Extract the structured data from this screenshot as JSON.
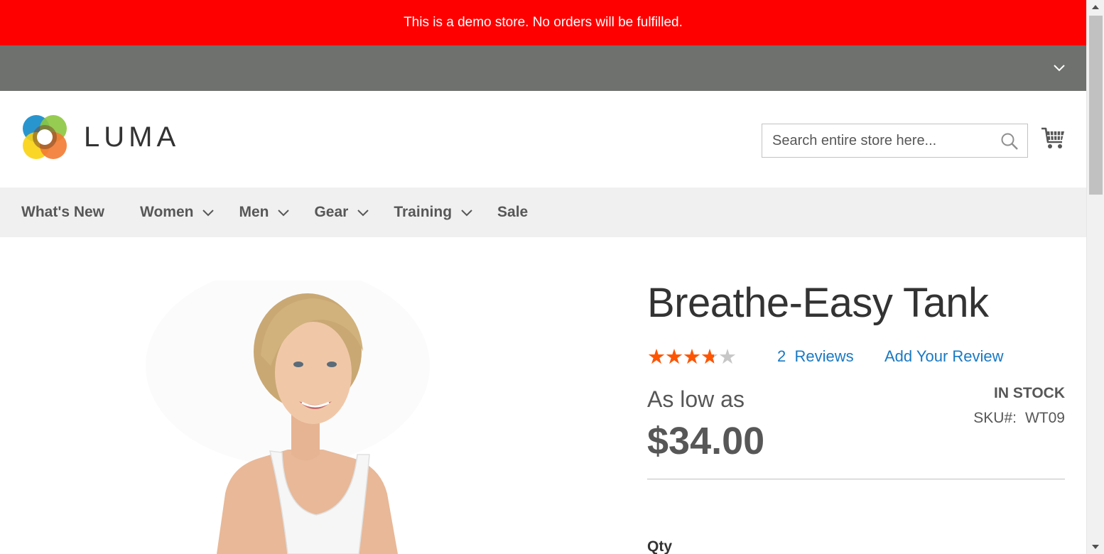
{
  "demo_notice": {
    "text": "This is a demo store. No orders will be fulfilled."
  },
  "header": {
    "logo_text": "LUMA",
    "search": {
      "placeholder": "Search entire store here...",
      "value": ""
    },
    "icons": {
      "search": "search-icon",
      "cart": "cart-icon",
      "toggle": "chevron-down-icon"
    }
  },
  "nav": {
    "items": [
      {
        "label": "What's New",
        "has_submenu": false
      },
      {
        "label": "Women",
        "has_submenu": true
      },
      {
        "label": "Men",
        "has_submenu": true
      },
      {
        "label": "Gear",
        "has_submenu": true
      },
      {
        "label": "Training",
        "has_submenu": true
      },
      {
        "label": "Sale",
        "has_submenu": false
      }
    ]
  },
  "product": {
    "title": "Breathe-Easy Tank",
    "rating": {
      "stars_out_of_5": 3.5
    },
    "reviews_label": "2  Reviews",
    "add_review_label": "Add Your Review",
    "price_prefix": "As low as",
    "price": "$34.00",
    "stock": "IN STOCK",
    "sku_label": "SKU#:",
    "sku_value": "WT09",
    "qty_label": "Qty"
  },
  "colors": {
    "notice_bg": "#ff0000",
    "panel_bg": "#6e716e",
    "nav_bg": "#f0f0f0",
    "link": "#1979c3",
    "star": "#ff5501"
  }
}
